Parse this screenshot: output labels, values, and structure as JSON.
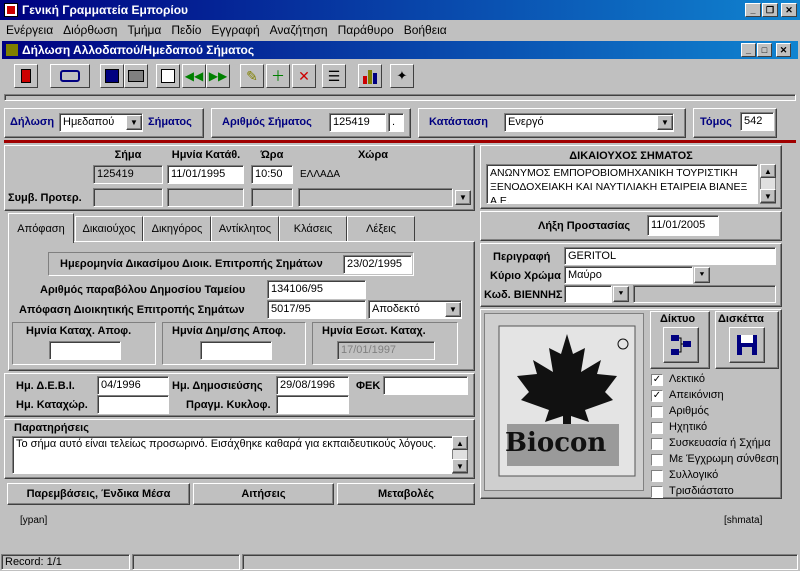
{
  "app": {
    "title": "Γενική Γραμματεία Εμπορίου"
  },
  "menu": [
    "Ενέργεια",
    "Διόρθωση",
    "Τμήμα",
    "Πεδίο",
    "Εγγραφή",
    "Αναζήτηση",
    "Παράθυρο",
    "Βοήθεια"
  ],
  "window": {
    "title": "Δήλωση Αλλοδαπού/Ημεδαπού Σήματος"
  },
  "toolbar": [
    "exit-icon",
    "search-icon",
    "save-icon",
    "print-icon",
    "edit-icon",
    "prev-icon",
    "next-icon",
    "pencil-icon",
    "insert-record-icon",
    "delete-record-icon",
    "list-icon",
    "chart-icon",
    "tools-icon"
  ],
  "header": {
    "declaration_label": "Δήλωση",
    "declaration_value": "Ημεδαπού",
    "declaration_suffix": "Σήματος",
    "number_label": "Αριθμός Σήματος",
    "number_value": "125419",
    "number_suffix": ".",
    "status_label": "Κατάσταση",
    "status_value": "Ενεργό",
    "volume_label": "Τόμος",
    "volume_value": "542"
  },
  "mark_table": {
    "headers": [
      "Σήμα",
      "Ημνία Κατάθ.",
      "Ώρα",
      "Χώρα"
    ],
    "mark": "125419",
    "date": "11/01/1995",
    "time": "10:50",
    "country": "ΕΛΛΑΔΑ",
    "prior_label": "Συμβ. Προτερ."
  },
  "tabs": [
    "Απόφαση",
    "Δικαιούχος",
    "Δικηγόρος",
    "Αντίκλητος",
    "Κλάσεις",
    "Λέξεις"
  ],
  "decision": {
    "court_date_label": "Ημερομηνία Δικασίμου Διοικ. Επιτροπής Σημάτων",
    "court_date": "23/02/1995",
    "fee_label": "Αριθμός παραβόλου Δημοσίου Ταμείου",
    "fee_value": "134106/95",
    "decision_label": "Απόφαση Διοικητικής Επιτροπής Σημάτων",
    "decision_value": "5017/95",
    "decision_result": "Αποδεκτό",
    "reg_date_label": "Ημνία Καταχ. Αποφ.",
    "reg_date": "",
    "pub_date_label": "Ημνία Δημ/σης Αποφ.",
    "pub_date": "",
    "internal_date_label": "Ημνία Εσωτ. Καταχ.",
    "internal_date": "17/01/1997"
  },
  "publication": {
    "debi_label": "Ημ. Δ.Ε.Β.Ι.",
    "debi": "04/1996",
    "pub_label": "Ημ. Δημοσιεύσης",
    "pub": "29/08/1996",
    "fek_label": "ΦΕΚ",
    "fek": "",
    "reg_label": "Ημ. Καταχώρ.",
    "reg": "",
    "circ_label": "Πραγμ. Κυκλοφ.",
    "circ": ""
  },
  "notes": {
    "label": "Παρατηρήσεις",
    "text": "Το σήμα αυτό είναι τελείως προσωρινό. Εισάχθηκε καθαρά για εκπαιδευτικούς λόγους."
  },
  "bottom_buttons": [
    "Παρεμβάσεις, Ένδικα Μέσα",
    "Αιτήσεις",
    "Μεταβολές"
  ],
  "owner": {
    "title": "ΔΙΚΑΙΟΥΧΟΣ ΣΗΜΑΤΟΣ",
    "text": "ΑΝΩΝΥΜΟΣ ΕΜΠΟΡΟΒΙΟΜΗΧΑΝΙΚΗ ΤΟΥΡΙΣΤΙΚΗ ΞΕΝΟΔΟΧΕΙΑΚΗ ΚΑΙ ΝΑΥΤΙΛΙΑΚΗ ΕΤΑΙΡΕΙΑ ΒΙΑΝΕΞ Α.Ε."
  },
  "protection": {
    "label": "Λήξη Προστασίας",
    "value": "11/01/2005"
  },
  "description": {
    "label": "Περιγραφή",
    "value": "GERITOL"
  },
  "color": {
    "label": "Κύριο Χρώμα",
    "value": "Μαύρο"
  },
  "vienna": {
    "label": "Κωδ. ΒΙΕΝΝΗΣ",
    "value": ""
  },
  "logo_text": "Biocon",
  "net_button": "Δίκτυο",
  "disk_button": "Δισκέττα",
  "checkboxes": [
    {
      "label": "Λεκτικό",
      "checked": true
    },
    {
      "label": "Απεικόνιση",
      "checked": true
    },
    {
      "label": "Αριθμός",
      "checked": false
    },
    {
      "label": "Ηχητικό",
      "checked": false
    },
    {
      "label": "Συσκευασία ή Σχήμα",
      "checked": false
    },
    {
      "label": "Με Έγχρωμη σύνθεση",
      "checked": false
    },
    {
      "label": "Συλλογικό",
      "checked": false
    },
    {
      "label": "Τρισδιάστατο",
      "checked": false
    }
  ],
  "footer": {
    "left": "[ypan]",
    "right": "[shmata]"
  },
  "status": {
    "record": "Record: 1/1"
  },
  "colors": {
    "title_start": "#000080",
    "title_end": "#1084d0",
    "accent_line": "#a00000"
  }
}
